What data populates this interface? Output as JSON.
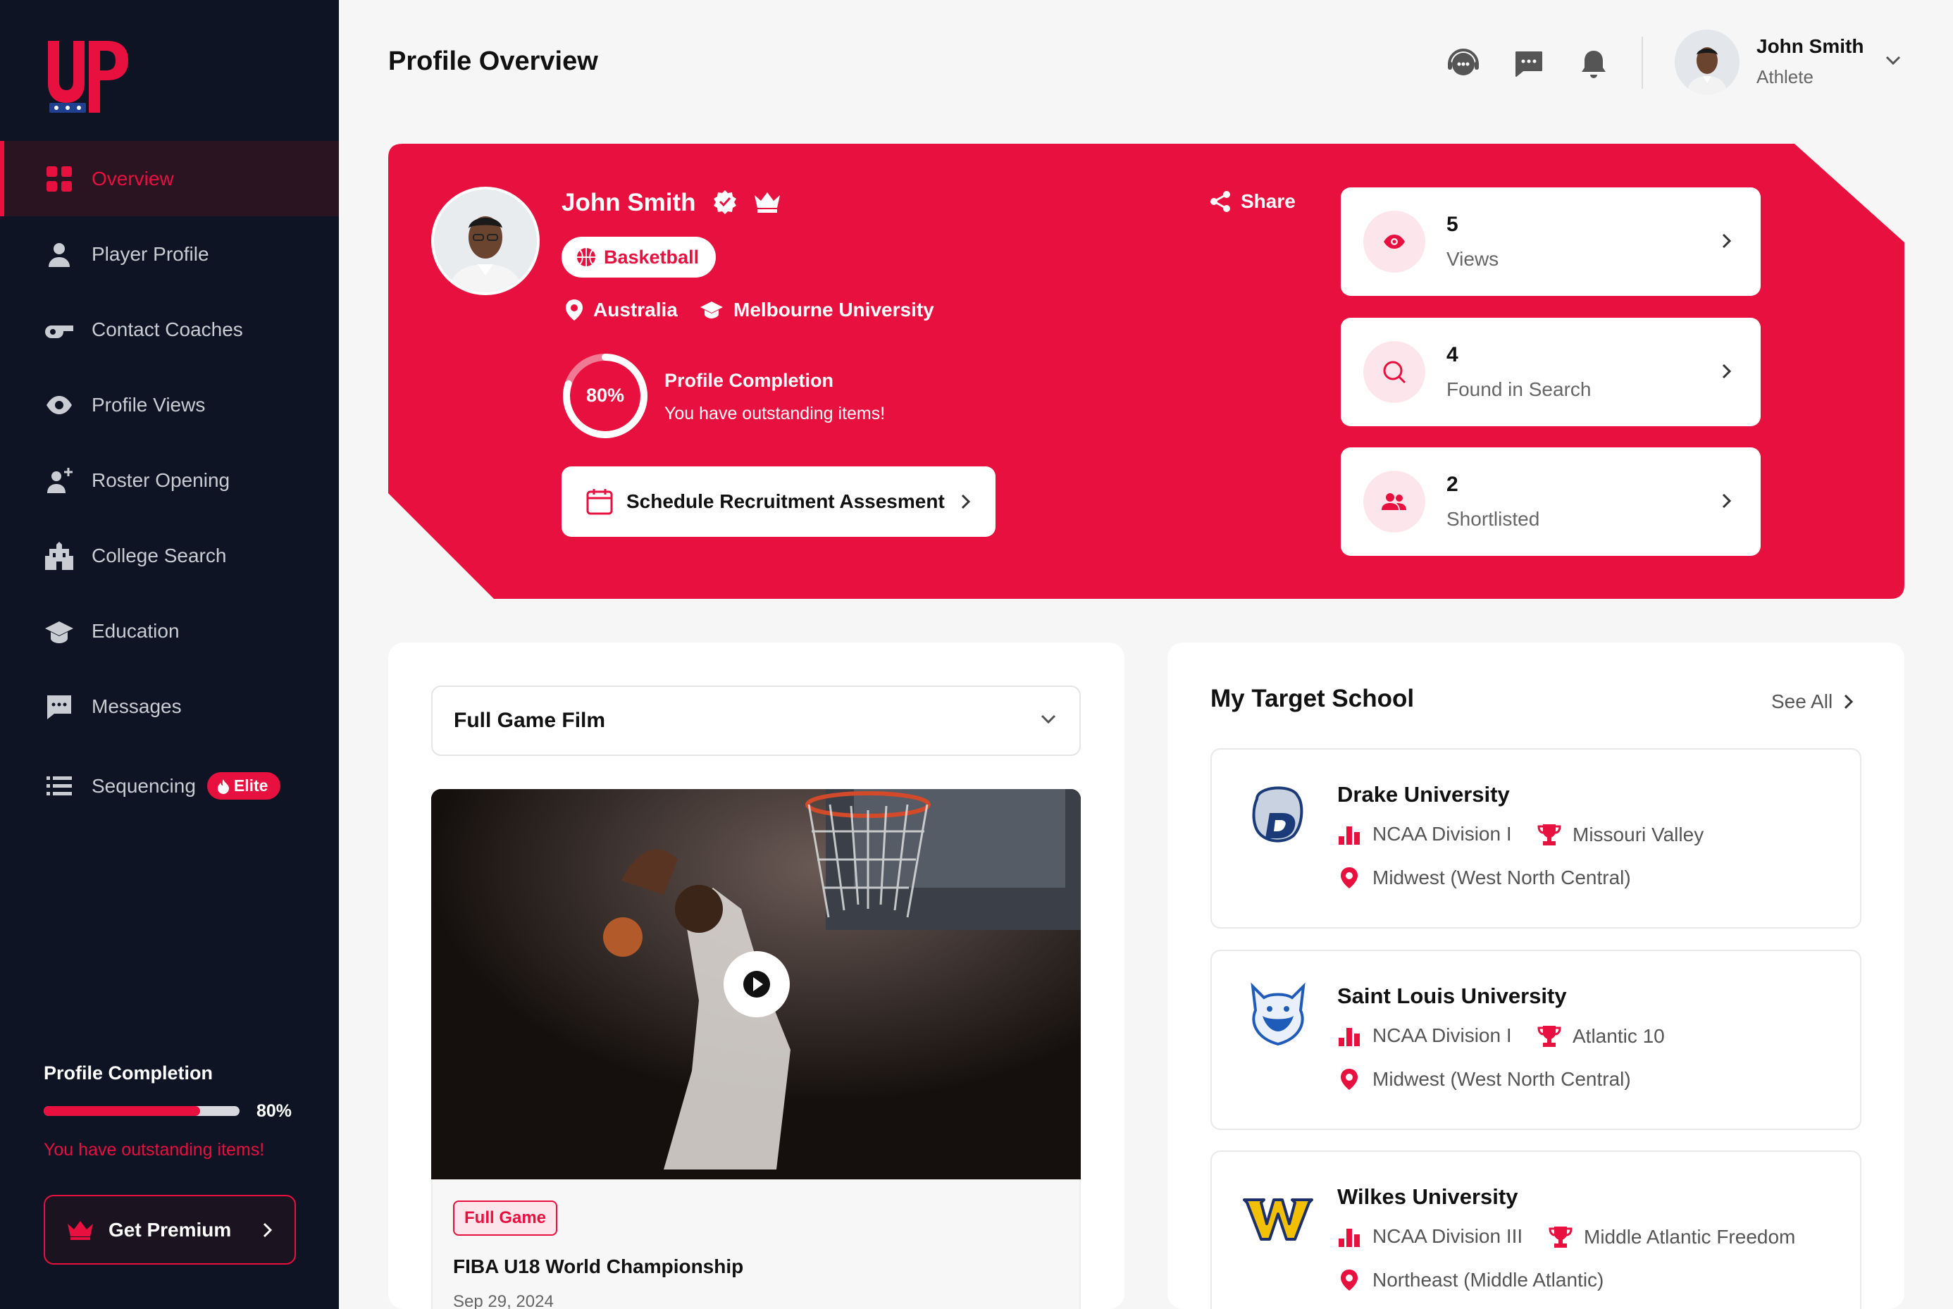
{
  "brand": {
    "logo_text": "UP",
    "accent": "#e8103e",
    "sidebar_bg": "#0f1424"
  },
  "sidebar": {
    "items": [
      {
        "label": "Overview",
        "icon": "grid-icon",
        "active": true
      },
      {
        "label": "Player Profile",
        "icon": "person-icon"
      },
      {
        "label": "Contact Coaches",
        "icon": "whistle-icon"
      },
      {
        "label": "Profile Views",
        "icon": "eye-icon"
      },
      {
        "label": "Roster Opening",
        "icon": "person-add-icon"
      },
      {
        "label": "College Search",
        "icon": "school-building-icon"
      },
      {
        "label": "Education",
        "icon": "graduation-cap-icon"
      },
      {
        "label": "Messages",
        "icon": "chat-icon"
      },
      {
        "label": "Sequencing",
        "icon": "list-icon",
        "badge": "Elite"
      }
    ],
    "completion": {
      "title": "Profile Completion",
      "percent_label": "80%",
      "percent": 80,
      "message": "You have outstanding items!"
    },
    "premium_label": "Get Premium"
  },
  "header": {
    "title": "Profile Overview",
    "icons": [
      "support-chat-icon",
      "message-icon",
      "bell-icon"
    ],
    "user": {
      "name": "John Smith",
      "role": "Athlete"
    }
  },
  "hero": {
    "name": "John Smith",
    "sport": "Basketball",
    "location": "Australia",
    "university": "Melbourne University",
    "completion_title": "Profile Completion",
    "completion_percent_label": "80%",
    "completion_percent": 80,
    "completion_message": "You have outstanding items!",
    "schedule_label": "Schedule Recruitment Assesment",
    "share_label": "Share",
    "stats": [
      {
        "value": "5",
        "label": "Views",
        "icon": "eye-icon"
      },
      {
        "value": "4",
        "label": "Found in Search",
        "icon": "search-icon"
      },
      {
        "value": "2",
        "label": "Shortlisted",
        "icon": "people-icon"
      }
    ]
  },
  "film": {
    "dropdown_value": "Full Game Film",
    "tag": "Full Game",
    "title": "FIBA U18 World Championship",
    "date": "Sep 29, 2024"
  },
  "target_schools": {
    "title": "My Target School",
    "see_all": "See All",
    "schools": [
      {
        "name": "Drake University",
        "division": "NCAA Division I",
        "conference": "Missouri Valley",
        "region": "Midwest (West North Central)",
        "logo": "bulldog-logo"
      },
      {
        "name": "Saint Louis University",
        "division": "NCAA Division I",
        "conference": "Atlantic 10",
        "region": "Midwest (West North Central)",
        "logo": "billiken-logo"
      },
      {
        "name": "Wilkes University",
        "division": "NCAA Division III",
        "conference": "Middle Atlantic Freedom",
        "region": "Northeast (Middle Atlantic)",
        "logo": "w-logo"
      }
    ]
  }
}
